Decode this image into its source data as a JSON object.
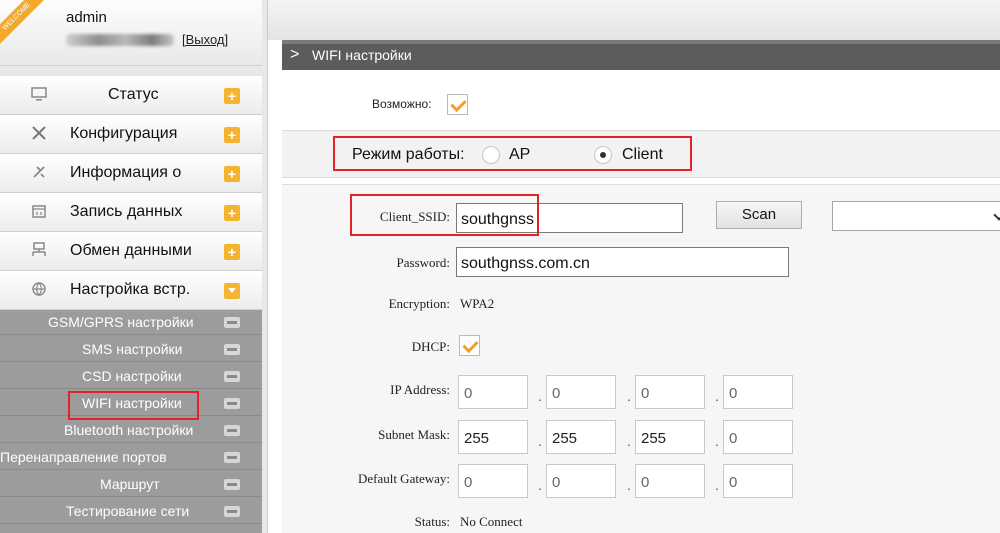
{
  "colors": {
    "accent_orange": "#f5b42f",
    "highlight_red": "#e0242a",
    "submenu_bg": "#9c9c9c",
    "titlebar_bg": "#5c5c5c"
  },
  "user": {
    "ribbon": "WELCOME",
    "name": "admin",
    "logout_label": "[Выход]"
  },
  "sidebar": {
    "items": [
      {
        "label": "Статус",
        "icon": "monitor-icon",
        "toggle": "+"
      },
      {
        "label": "Конфигурация",
        "icon": "tools-icon",
        "toggle": "+"
      },
      {
        "label": "Информация о",
        "icon": "satellite-icon",
        "toggle": "+"
      },
      {
        "label": "Запись данных",
        "icon": "calendar-icon",
        "toggle": "+"
      },
      {
        "label": "Обмен данными",
        "icon": "network-icon",
        "toggle": "+"
      },
      {
        "label": "Настройка встр.",
        "icon": "globe-icon",
        "toggle": "expanded"
      }
    ],
    "subitems": [
      {
        "label": "GSM/GPRS настройки"
      },
      {
        "label": "SMS настройки"
      },
      {
        "label": "CSD настройки"
      },
      {
        "label": "WIFI настройки",
        "selected": true
      },
      {
        "label": "Bluetooth настройки"
      },
      {
        "label": "Перенаправление портов"
      },
      {
        "label": "Маршрут"
      },
      {
        "label": "Тестирование сети"
      }
    ]
  },
  "main": {
    "title_chevron": ">",
    "title": "WIFI настройки",
    "enable_label": "Возможно:",
    "enable_checked": true,
    "mode": {
      "label": "Режим работы:",
      "options": [
        "AP",
        "Client"
      ],
      "selected": "Client"
    },
    "form": {
      "ssid": {
        "label": "Client_SSID:",
        "value": "southgnss"
      },
      "scan_label": "Scan",
      "ssid_select_value": "",
      "password": {
        "label": "Password:",
        "value": "southgnss.com.cn"
      },
      "encryption": {
        "label": "Encryption:",
        "value": "WPA2"
      },
      "dhcp": {
        "label": "DHCP:",
        "checked": true
      },
      "ip_address": {
        "label": "IP Address:",
        "octets": [
          "0",
          "0",
          "0",
          "0"
        ]
      },
      "subnet_mask": {
        "label": "Subnet Mask:",
        "octets": [
          "255",
          "255",
          "255",
          "0"
        ]
      },
      "default_gateway": {
        "label": "Default Gateway:",
        "octets": [
          "0",
          "0",
          "0",
          "0"
        ]
      },
      "status": {
        "label": "Status:",
        "value": "No Connect"
      },
      "octet_separator": "."
    }
  }
}
